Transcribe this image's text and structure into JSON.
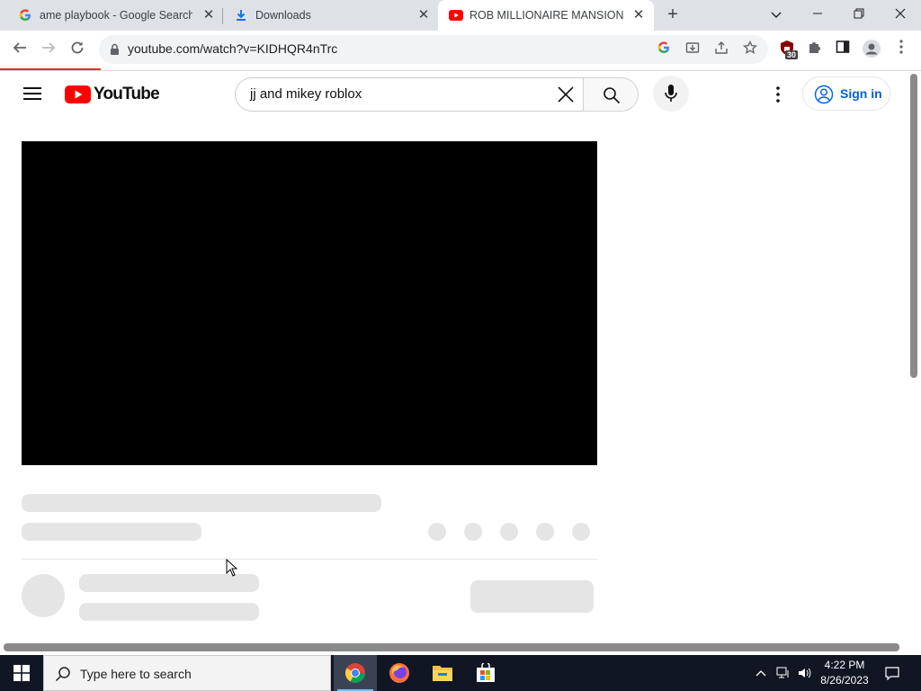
{
  "browser": {
    "tabs": [
      {
        "title": "ame playbook - Google Search",
        "favicon": "google-g-icon",
        "active": false
      },
      {
        "title": "Downloads",
        "favicon": "download-icon",
        "active": false
      },
      {
        "title": "ROB MILLIONAIRE MANSION - F",
        "favicon": "youtube-icon",
        "active": true
      }
    ],
    "url": "youtube.com/watch?v=KIDHQR4nTrc",
    "extension_badge": "30"
  },
  "youtube": {
    "logo_text": "YouTube",
    "search_query": "jj and mikey roblox",
    "signin_label": "Sign in"
  },
  "taskbar": {
    "search_placeholder": "Type here to search",
    "time": "4:22 PM",
    "date": "8/26/2023"
  },
  "colors": {
    "youtube_red": "#ff0000",
    "signin_blue": "#065fd4",
    "taskbar_bg": "#101624"
  }
}
